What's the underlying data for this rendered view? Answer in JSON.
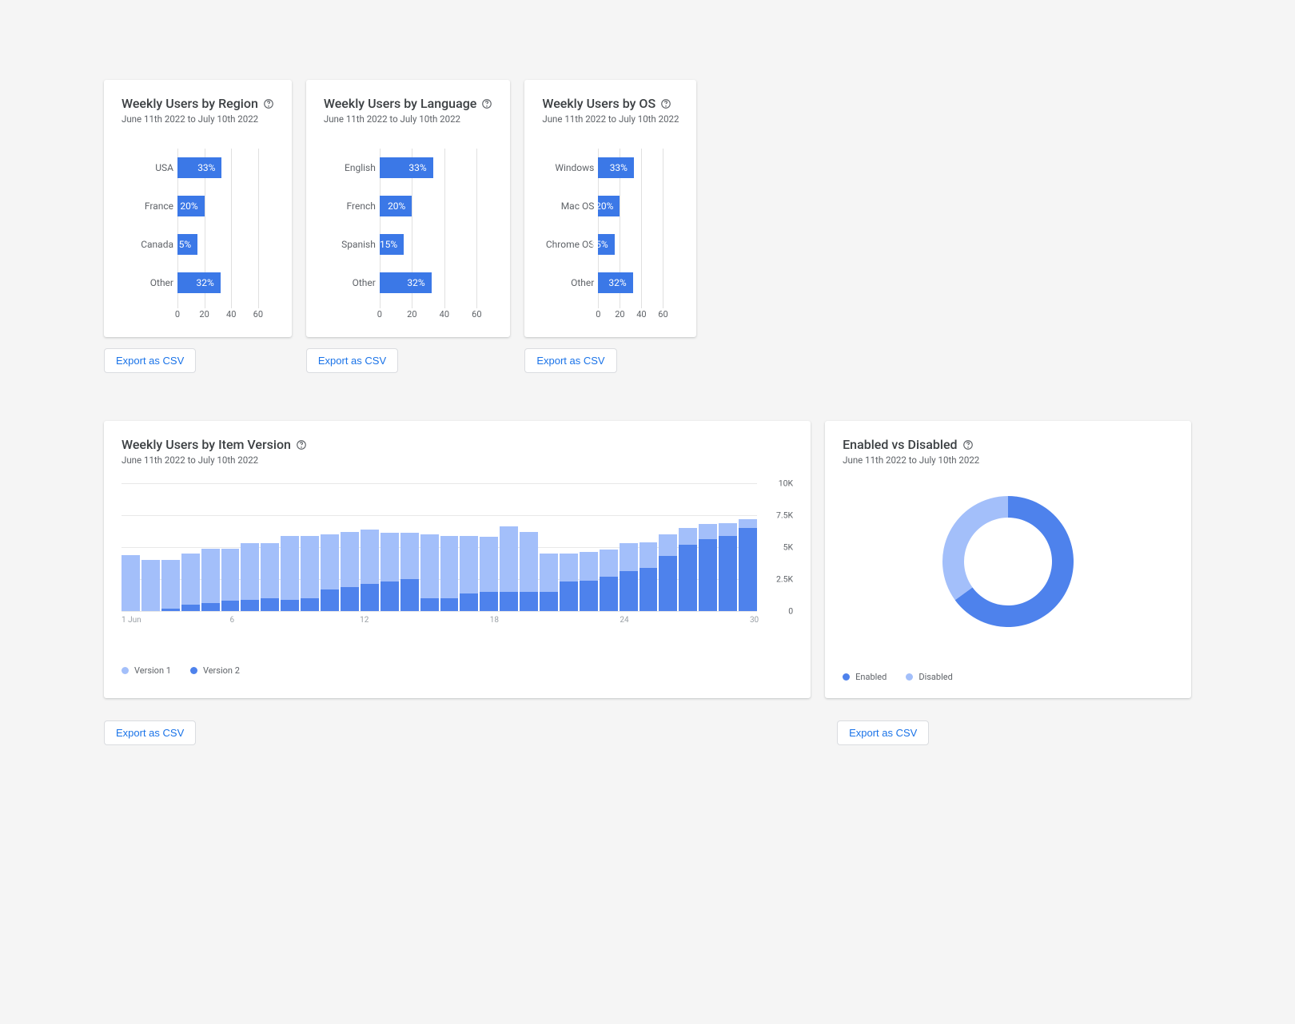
{
  "dateRange": "June 11th 2022 to July 10th 2022",
  "exportLabel": "Export as CSV",
  "region": {
    "title": "Weekly Users by Region"
  },
  "language": {
    "title": "Weekly Users by Language"
  },
  "os": {
    "title": "Weekly Users by OS"
  },
  "version": {
    "title": "Weekly Users by Item Version"
  },
  "enabled": {
    "title": "Enabled vs Disabled"
  },
  "legend": {
    "v1": "Version 1",
    "v2": "Version 2",
    "enabled": "Enabled",
    "disabled": "Disabled"
  },
  "chart_data": [
    {
      "id": "region",
      "type": "bar",
      "orientation": "horizontal",
      "categories": [
        "USA",
        "France",
        "Canada",
        "Other"
      ],
      "values": [
        33,
        20,
        15,
        32
      ],
      "value_suffix": "%",
      "xticks": [
        0,
        20,
        40,
        60
      ],
      "xlim": [
        0,
        60
      ]
    },
    {
      "id": "language",
      "type": "bar",
      "orientation": "horizontal",
      "categories": [
        "English",
        "French",
        "Spanish",
        "Other"
      ],
      "values": [
        33,
        20,
        15,
        32
      ],
      "value_suffix": "%",
      "xticks": [
        0,
        20,
        40,
        60
      ],
      "xlim": [
        0,
        60
      ]
    },
    {
      "id": "os",
      "type": "bar",
      "orientation": "horizontal",
      "categories": [
        "Windows",
        "Mac OS",
        "Chrome OS",
        "Other"
      ],
      "values": [
        33,
        20,
        15,
        32
      ],
      "value_suffix": "%",
      "xticks": [
        0,
        20,
        40,
        60
      ],
      "xlim": [
        0,
        60
      ]
    },
    {
      "id": "version",
      "type": "bar",
      "orientation": "vertical",
      "stacked": true,
      "x_label_start": "1 Jun",
      "x_ticks": [
        "1 Jun",
        "6",
        "12",
        "18",
        "24",
        "30"
      ],
      "x_tick_positions": [
        0,
        5,
        11,
        17,
        23,
        29
      ],
      "yticks": [
        0,
        2500,
        5000,
        7500,
        10000
      ],
      "ytick_labels": [
        "0",
        "2.5K",
        "5K",
        "7.5K",
        "10K"
      ],
      "ylim": [
        0,
        10000
      ],
      "series": [
        {
          "name": "Version 1",
          "color": "#a3bffa",
          "values": [
            4400,
            4000,
            3800,
            4000,
            4300,
            4100,
            4400,
            4300,
            5000,
            4900,
            4300,
            4300,
            4300,
            3800,
            3600,
            5000,
            4900,
            4500,
            4300,
            5100,
            4700,
            3000,
            2200,
            2200,
            2100,
            2200,
            2000,
            1700,
            1300,
            1200,
            1000,
            700
          ]
        },
        {
          "name": "Version 2",
          "color": "#4e82ec",
          "values": [
            0,
            0,
            200,
            500,
            600,
            800,
            900,
            1000,
            900,
            1000,
            1700,
            1900,
            2100,
            2300,
            2500,
            1000,
            1000,
            1400,
            1500,
            1500,
            1500,
            1500,
            2300,
            2400,
            2700,
            3100,
            3400,
            4300,
            5200,
            5600,
            5900,
            6500
          ]
        }
      ]
    },
    {
      "id": "enabled",
      "type": "pie",
      "donut": true,
      "categories": [
        "Enabled",
        "Disabled"
      ],
      "values": [
        65,
        35
      ],
      "colors": [
        "#4e82ec",
        "#a3bffa"
      ]
    }
  ]
}
